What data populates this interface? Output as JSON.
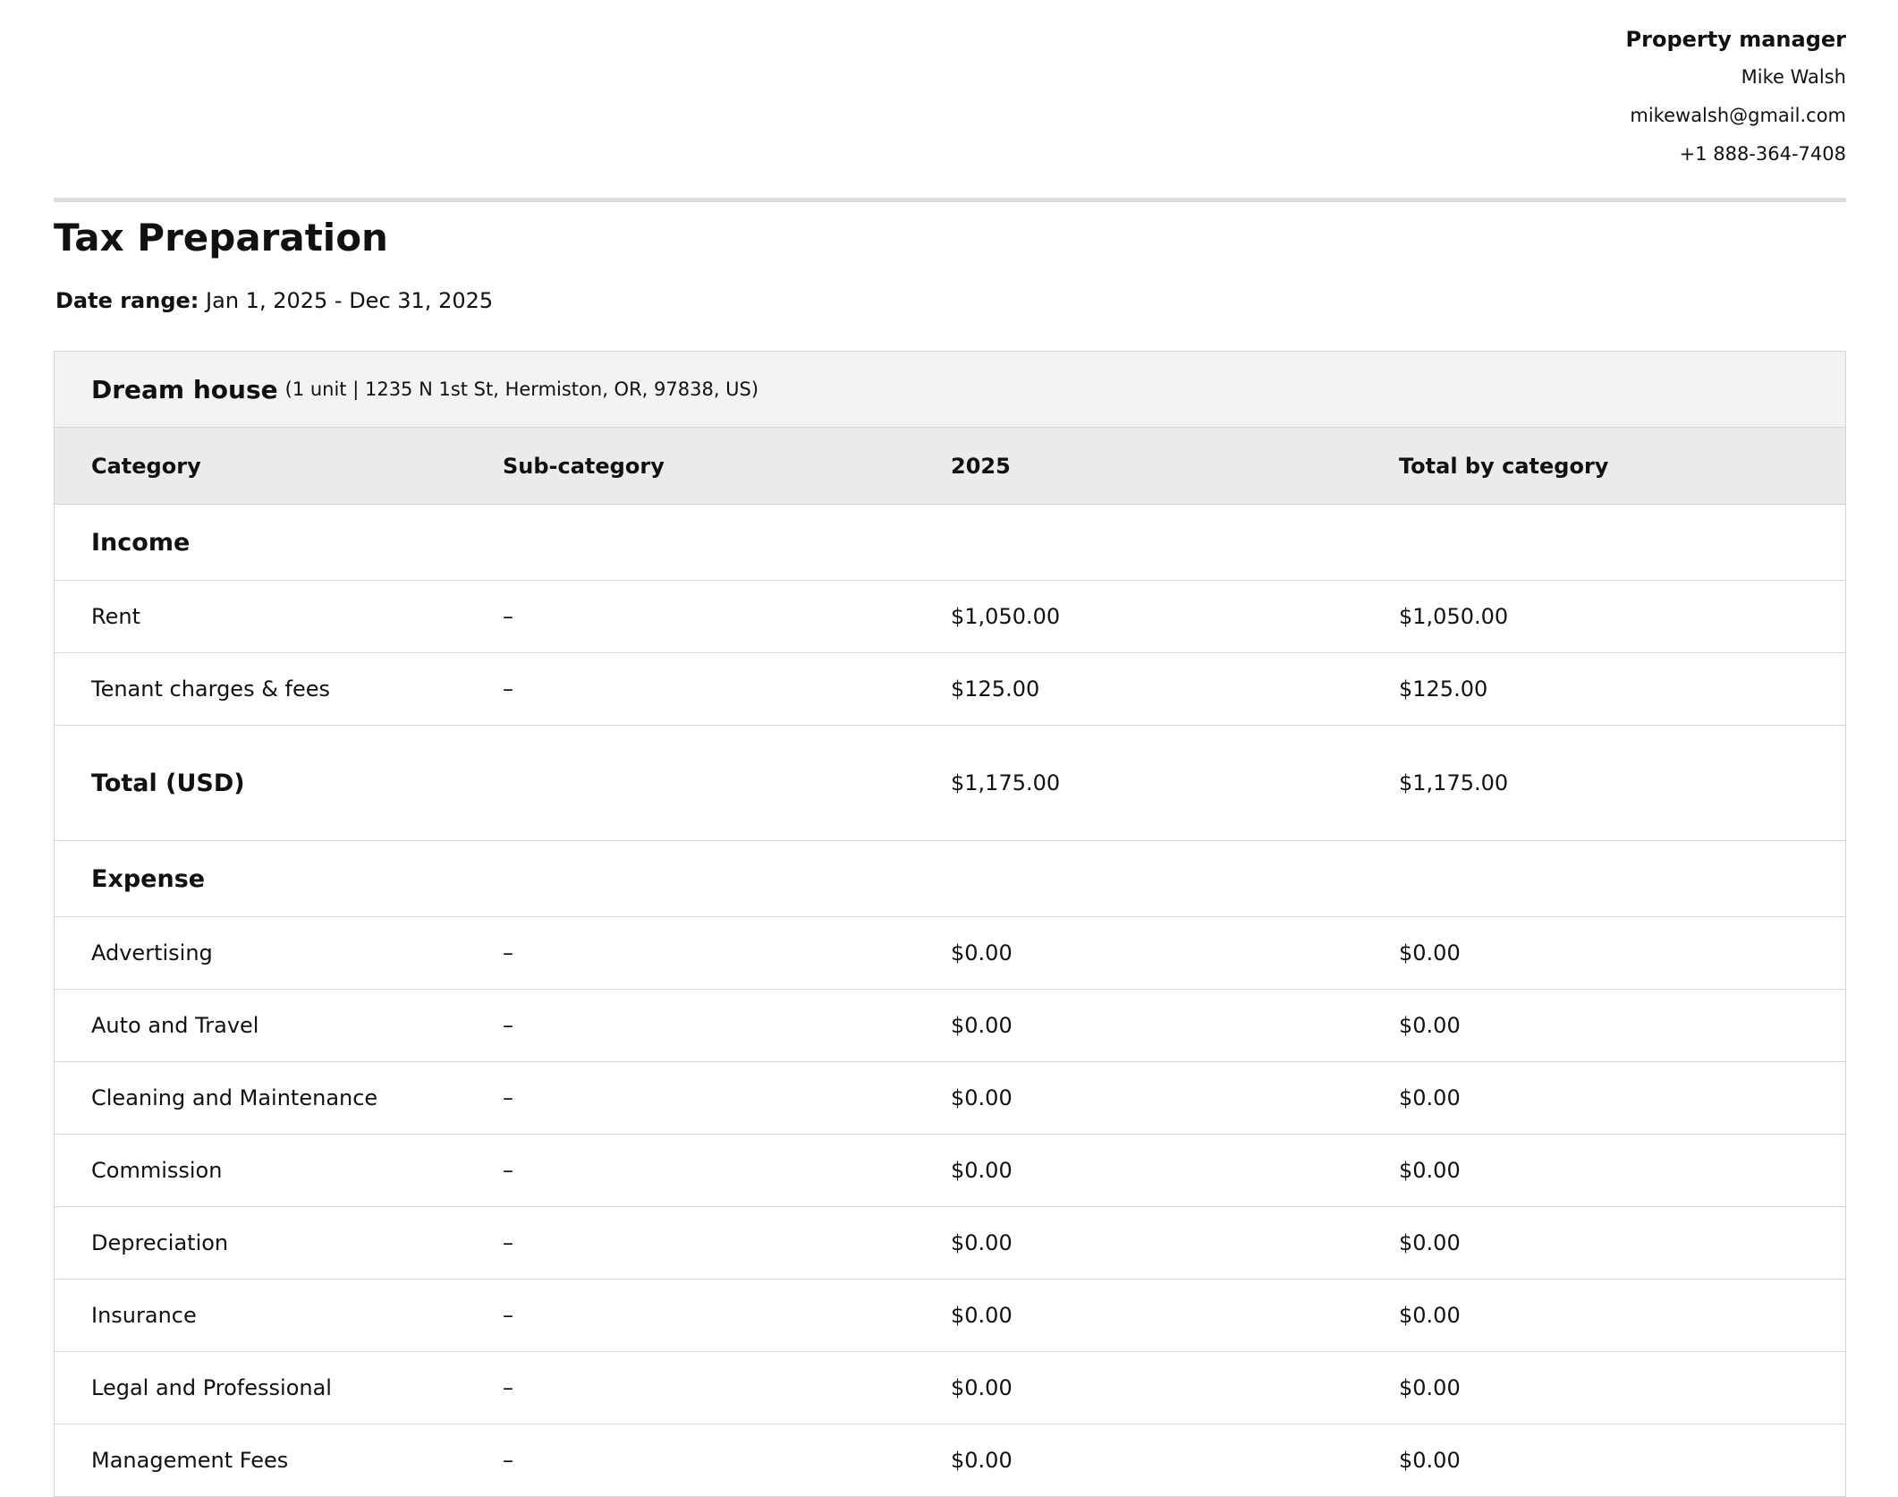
{
  "manager": {
    "heading": "Property manager",
    "name": "Mike Walsh",
    "email": "mikewalsh@gmail.com",
    "phone": "+1 888-364-7408"
  },
  "report": {
    "title": "Tax Preparation",
    "date_range_label": "Date range:",
    "date_range_value": "Jan 1, 2025 - Dec 31, 2025"
  },
  "property": {
    "name": "Dream house",
    "details": "(1 unit | 1235 N 1st St, Hermiston, OR, 97838, US)"
  },
  "table": {
    "columns": [
      "Category",
      "Sub-category",
      "2025",
      "Total by category"
    ],
    "income": {
      "label": "Income",
      "rows": [
        {
          "category": "Rent",
          "sub": "–",
          "year": "$1,050.00",
          "total": "$1,050.00"
        },
        {
          "category": "Tenant charges & fees",
          "sub": "–",
          "year": "$125.00",
          "total": "$125.00"
        }
      ],
      "total": {
        "label": "Total (USD)",
        "year": "$1,175.00",
        "total": "$1,175.00"
      }
    },
    "expense": {
      "label": "Expense",
      "rows": [
        {
          "category": "Advertising",
          "sub": "–",
          "year": "$0.00",
          "total": "$0.00"
        },
        {
          "category": "Auto and Travel",
          "sub": "–",
          "year": "$0.00",
          "total": "$0.00"
        },
        {
          "category": "Cleaning and Maintenance",
          "sub": "–",
          "year": "$0.00",
          "total": "$0.00"
        },
        {
          "category": "Commission",
          "sub": "–",
          "year": "$0.00",
          "total": "$0.00"
        },
        {
          "category": "Depreciation",
          "sub": "–",
          "year": "$0.00",
          "total": "$0.00"
        },
        {
          "category": "Insurance",
          "sub": "–",
          "year": "$0.00",
          "total": "$0.00"
        },
        {
          "category": "Legal and Professional",
          "sub": "–",
          "year": "$0.00",
          "total": "$0.00"
        },
        {
          "category": "Management Fees",
          "sub": "–",
          "year": "$0.00",
          "total": "$0.00"
        }
      ]
    }
  }
}
